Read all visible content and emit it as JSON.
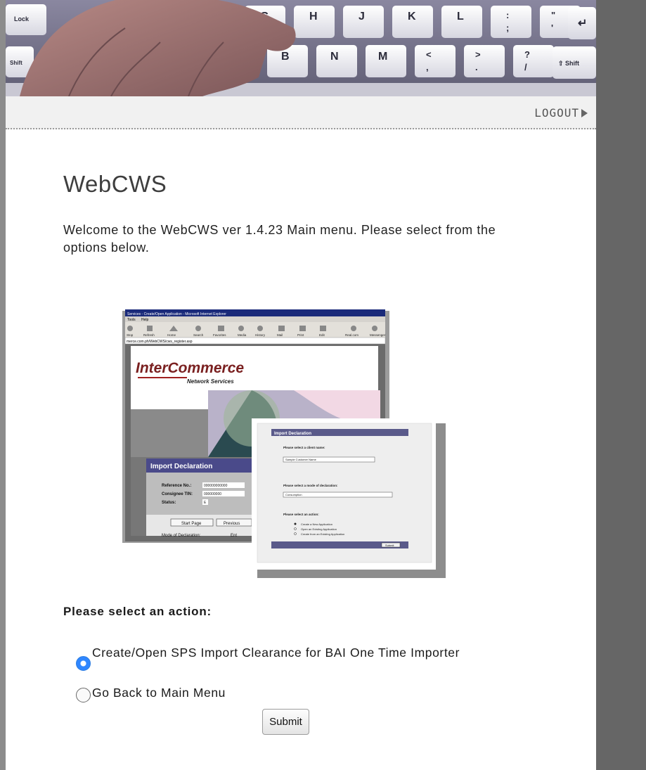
{
  "header": {
    "logout_label": "LOGOUT",
    "banner_keys": [
      "Lock",
      "G",
      "H",
      "J",
      "K",
      "L",
      ":",
      ";",
      "\"",
      "'",
      "↵",
      "Shift",
      "B",
      "N",
      "M",
      "<",
      ",",
      ">",
      ".",
      "?",
      "/",
      "⇧ Shift"
    ]
  },
  "main": {
    "title": "WebCWS",
    "welcome": "Welcome to the WebCWS ver 1.4.23 Main menu. Please select from the options below."
  },
  "illustration": {
    "window_title": "Services - Create/Open Application - Microsoft Internet Explorer",
    "menu": [
      "Tools",
      "Help"
    ],
    "toolbar": [
      "Stop",
      "Refresh",
      "Home",
      "Search",
      "Favorites",
      "Media",
      "History",
      "Mail",
      "Print",
      "Edit",
      "Real.com",
      "Messenger"
    ],
    "address": "merce.com.ph/WebCWS/cws_register.asp",
    "logo_main": "InterCommerce",
    "logo_sub": "Network Services",
    "panel_title": "Import Declaration",
    "fields": [
      "Reference No.:",
      "Consignee TIN:",
      "Status:"
    ],
    "field_values": [
      "000000000000",
      "000000000",
      "E"
    ],
    "buttons": [
      "Start Page",
      "Previous"
    ],
    "footer_label": "Mode of Declaration:",
    "footer_value": "Ent",
    "dialog_title": "Import Declaration",
    "dialog_labels": [
      "Please select a client name:",
      "Please select a mode of declaration:",
      "Please select an action:"
    ],
    "dialog_select1": "Sample Customer Name",
    "dialog_select2": "Consumption",
    "dialog_options": [
      "Create a New Application",
      "Open an Existing Application",
      "Create from an Existing Application"
    ],
    "dialog_submit": "Submit"
  },
  "form": {
    "heading": "Please select an action:",
    "options": [
      {
        "label": "Create/Open SPS Import Clearance for BAI One Time Importer",
        "selected": true
      },
      {
        "label": "Go Back to Main Menu",
        "selected": false
      }
    ],
    "submit_label": "Submit"
  },
  "colors": {
    "radio_selected": "#2f86ff",
    "page_bg": "#666666",
    "banner": "#77758b"
  }
}
